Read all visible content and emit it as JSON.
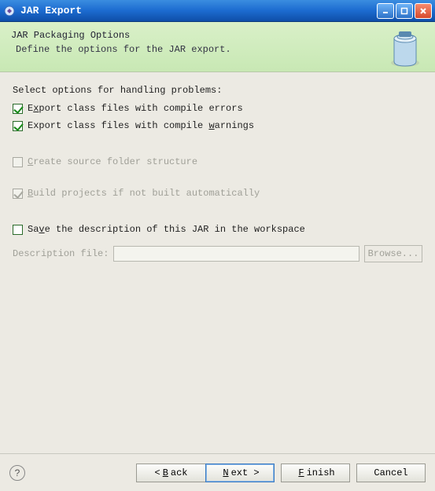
{
  "window": {
    "title": "JAR Export"
  },
  "header": {
    "title": "JAR Packaging Options",
    "subtitle": "Define the options for the JAR export."
  },
  "options": {
    "problems_label": "Select options for handling problems:",
    "export_errors": {
      "label_pre": "E",
      "label_mn": "x",
      "label_post": "port class files with compile errors",
      "checked": true,
      "enabled": true
    },
    "export_warnings": {
      "label_pre": "Export class files with compile ",
      "label_mn": "w",
      "label_post": "arnings",
      "checked": true,
      "enabled": true
    },
    "create_source": {
      "label_pre": "",
      "label_mn": "C",
      "label_post": "reate source folder structure",
      "checked": false,
      "enabled": false
    },
    "build_projects": {
      "label_pre": "",
      "label_mn": "B",
      "label_post": "uild projects if not built automatically",
      "checked": true,
      "enabled": false
    },
    "save_description": {
      "label_pre": "Sa",
      "label_mn": "v",
      "label_post": "e the description of this JAR in the workspace",
      "checked": false,
      "enabled": true
    }
  },
  "description": {
    "label_pre": "",
    "label_mn": "D",
    "label_post": "escription file:",
    "value": "",
    "browse_label": "Browse..."
  },
  "footer": {
    "back_pre": "< ",
    "back_mn": "B",
    "back_post": "ack",
    "next_pre": "",
    "next_mn": "N",
    "next_post": "ext >",
    "finish_pre": "",
    "finish_mn": "F",
    "finish_post": "inish",
    "cancel": "Cancel"
  }
}
